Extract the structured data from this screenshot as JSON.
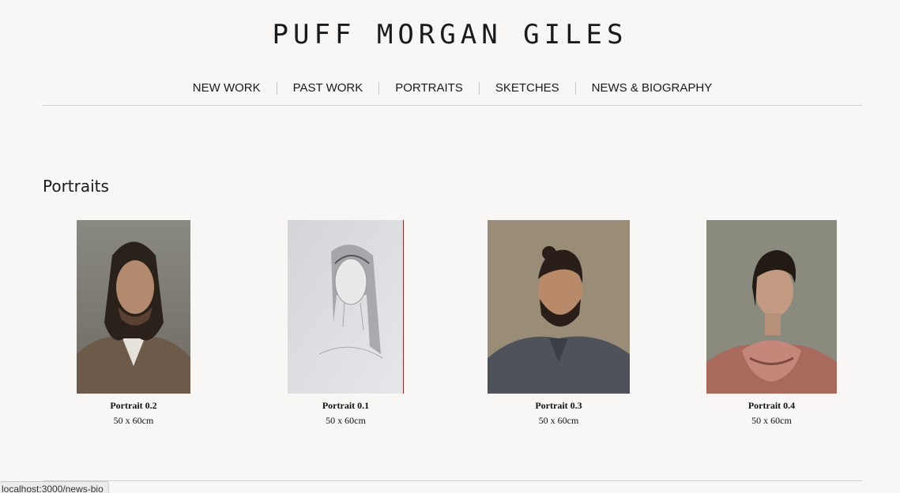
{
  "site": {
    "title": "PUFF MORGAN GILES"
  },
  "nav": {
    "items": [
      {
        "label": "NEW WORK"
      },
      {
        "label": "PAST WORK"
      },
      {
        "label": "PORTRAITS"
      },
      {
        "label": "SKETCHES"
      },
      {
        "label": "NEWS & BIOGRAPHY"
      }
    ]
  },
  "main": {
    "heading": "Portraits",
    "artworks": [
      {
        "title": "Portrait 0.2",
        "size": "50 x 60cm"
      },
      {
        "title": "Portrait 0.1",
        "size": "50 x 60cm"
      },
      {
        "title": "Portrait 0.3",
        "size": "50 x 60cm"
      },
      {
        "title": "Portrait 0.4",
        "size": "50 x 60cm"
      }
    ]
  },
  "status_bar": {
    "url": "localhost:3000/news-bio"
  },
  "colors": {
    "background": "#f9f7f5",
    "text": "#1a1a1a",
    "divider": "#cfcfcf"
  }
}
